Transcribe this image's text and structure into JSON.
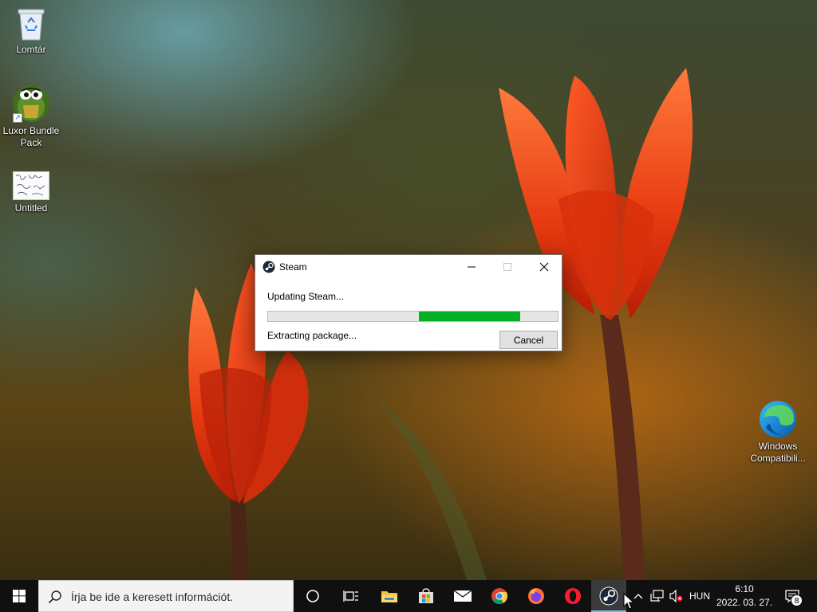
{
  "desktop": {
    "icons": [
      {
        "label": "Lomtár",
        "icon": "recycle-bin-icon"
      },
      {
        "label": "Luxor Bundle Pack",
        "icon": "luxor-game-icon"
      },
      {
        "label": "Untitled",
        "icon": "paint-image-icon"
      },
      {
        "label": "Windows Compatibili...",
        "icon": "edge-browser-icon"
      }
    ]
  },
  "dialog": {
    "title": "Steam",
    "status": "Updating Steam...",
    "detail": "Extracting package...",
    "progress": {
      "fill_start": 0.52,
      "fill_end": 0.87,
      "color": "#06b025"
    },
    "cancel_label": "Cancel"
  },
  "taskbar": {
    "search_placeholder": "Írja be ide a keresett információt.",
    "pinned": [
      "windows-start-icon",
      "cortana-icon",
      "task-view-icon",
      "file-explorer-icon",
      "store-icon",
      "mail-icon",
      "chrome-icon",
      "firefox-icon",
      "opera-icon",
      "steam-icon"
    ],
    "active_app": "steam-icon",
    "language": "HUN",
    "time": "6:10",
    "date": "2022. 03. 27.",
    "notification_count": "8"
  },
  "colors": {
    "taskbar": "#101010",
    "accent": "#76b9ed",
    "progress": "#06b025"
  }
}
